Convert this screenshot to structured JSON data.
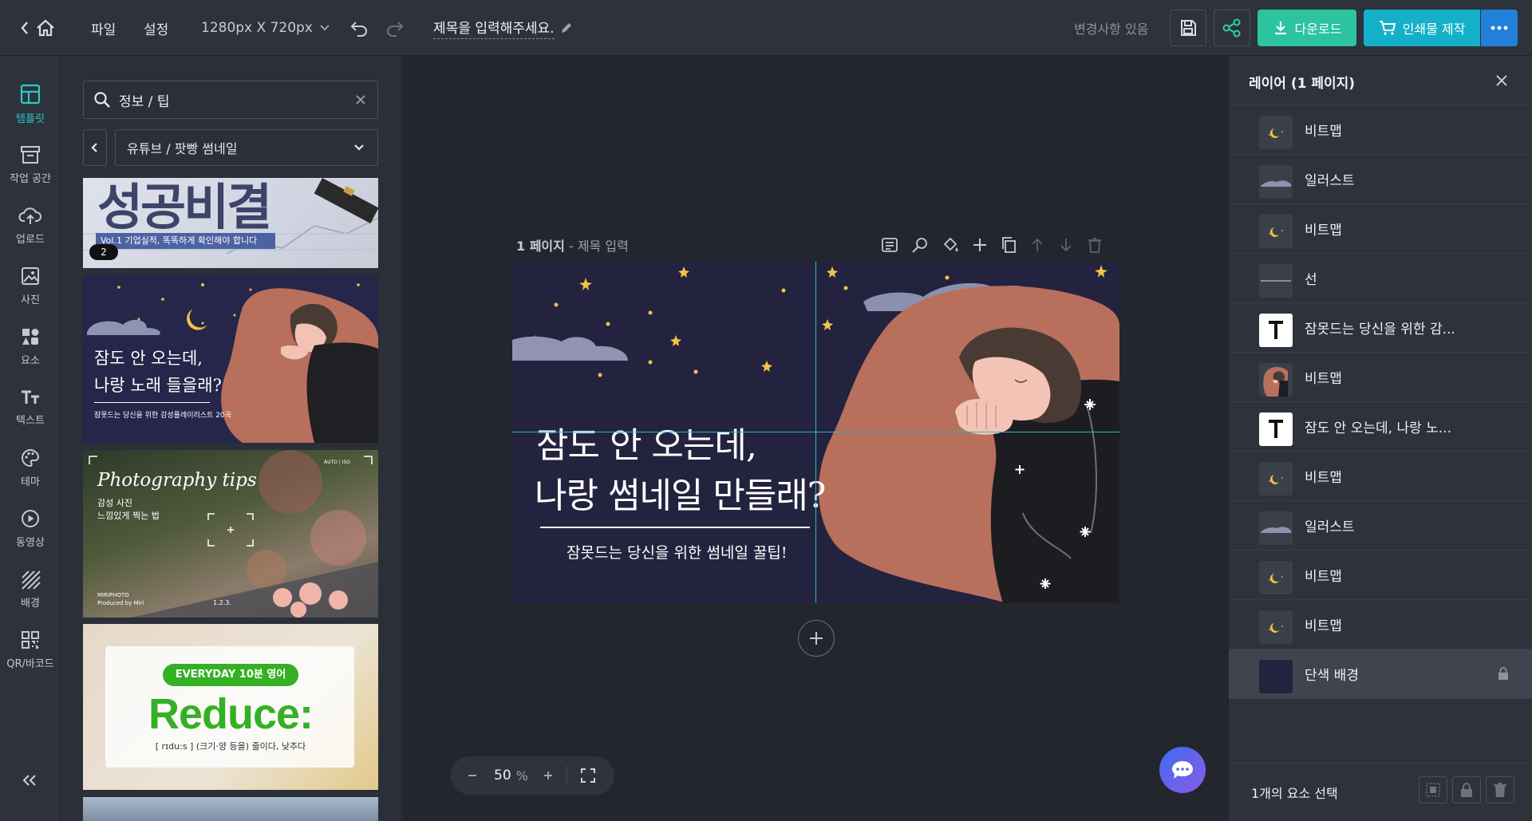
{
  "topbar": {
    "file_label": "파일",
    "settings_label": "설정",
    "size_label": "1280px X 720px",
    "title_placeholder": "제목을 입력해주세요.",
    "status_label": "변경사항 있음",
    "download_label": "다운로드",
    "print_label": "인쇄물 제작"
  },
  "nav": {
    "items": [
      {
        "label": "템플릿",
        "icon": "template-icon",
        "active": true
      },
      {
        "label": "작업 공간",
        "icon": "workspace-icon"
      },
      {
        "label": "업로드",
        "icon": "upload-icon"
      },
      {
        "label": "사진",
        "icon": "photo-icon"
      },
      {
        "label": "요소",
        "icon": "elements-icon"
      },
      {
        "label": "텍스트",
        "icon": "text-icon"
      },
      {
        "label": "테마",
        "icon": "palette-icon"
      },
      {
        "label": "동영상",
        "icon": "video-icon"
      },
      {
        "label": "배경",
        "icon": "background-icon"
      },
      {
        "label": "QR/바코드",
        "icon": "qr-icon"
      }
    ]
  },
  "templates": {
    "search_value": "정보 / 팁",
    "category": "유튜브 / 팟빵 썸네일",
    "items": [
      {
        "headline": "성공비결",
        "sub": "Vol.1  기업실적, 똑똑하게 확인해야 합니다",
        "badge": "2"
      },
      {
        "line1": "잠도 안 오는데,",
        "line2": "나랑 노래 들을래?",
        "sub": "잠못드는 당신을 위한 감성플레이리스트 20곡"
      },
      {
        "headline": "Photography tips",
        "sub1": "감성 사진",
        "sub2": "느낌있게 찍는 법",
        "credit1": "MIRIPHOTO",
        "credit2": "Produced by Miri",
        "counter": "1.2.3.",
        "topright": "AUTO  |  ISO"
      },
      {
        "pill": "EVERYDAY 10분 영어",
        "word": "Reduce:",
        "sub": "[ rɪdu:s ] (크기·양 등을) 줄이다, 낮추다"
      }
    ]
  },
  "canvas": {
    "page_label": "1 페이지",
    "page_subtitle": "- 제목 입력",
    "line1": "잠도 안 오는데,",
    "line2": "나랑 썸네일 만들래?",
    "sub": "잠못드는 당신을 위한 썸네일 꿀팁!"
  },
  "zoom": {
    "value": "50",
    "unit": "%"
  },
  "layers": {
    "title": "레이어 (1 페이지)",
    "items": [
      {
        "name": "비트맵",
        "thumb": "moon"
      },
      {
        "name": "일러스트",
        "thumb": "cloud"
      },
      {
        "name": "비트맵",
        "thumb": "moon"
      },
      {
        "name": "선",
        "thumb": "line"
      },
      {
        "name": "잠못드는 당신을 위한 감...",
        "thumb": "text"
      },
      {
        "name": "비트맵",
        "thumb": "person"
      },
      {
        "name": "잠도 안 오는데, 나랑 노...",
        "thumb": "text"
      },
      {
        "name": "비트맵",
        "thumb": "moon"
      },
      {
        "name": "일러스트",
        "thumb": "cloud"
      },
      {
        "name": "비트맵",
        "thumb": "moon"
      },
      {
        "name": "비트맵",
        "thumb": "moon"
      },
      {
        "name": "단색 배경",
        "thumb": "solid"
      }
    ],
    "footer_label": "1개의 요소 선택"
  },
  "colors": {
    "accent_teal": "#2bb9c6",
    "download_green": "#2bc3a0",
    "print_cyan": "#14b0c9",
    "canvas_bg": "#23233f",
    "moon": "#f4c245",
    "pillow": "#b86f5c"
  }
}
